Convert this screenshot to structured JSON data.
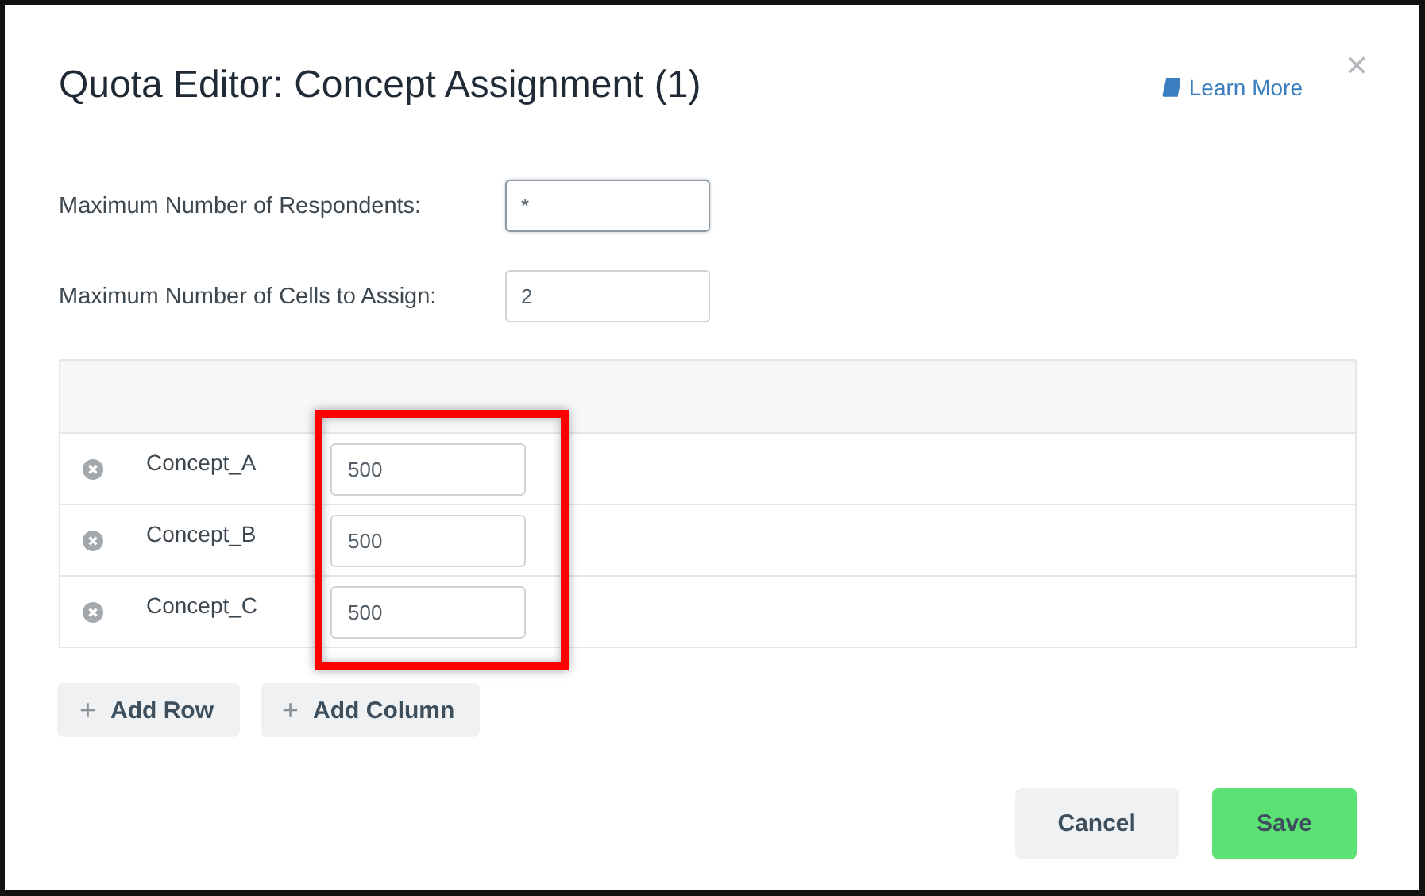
{
  "dialog": {
    "title": "Quota Editor: Concept Assignment (1)",
    "help_link": "Learn More",
    "close": "×"
  },
  "settings": [
    {
      "label": "Maximum Number of Respondents:",
      "value": "*",
      "focused": true
    },
    {
      "label": "Maximum Number of Cells to Assign:",
      "value": "2",
      "focused": false
    }
  ],
  "table": {
    "rows": [
      {
        "name": "Concept_A",
        "value": "500"
      },
      {
        "name": "Concept_B",
        "value": "500"
      },
      {
        "name": "Concept_C",
        "value": "500"
      }
    ]
  },
  "table_buttons": [
    {
      "icon": "+",
      "label": "Add Row"
    },
    {
      "icon": "+",
      "label": "Add Column"
    }
  ],
  "footer_buttons": [
    {
      "label": "Cancel",
      "kind": "secondary"
    },
    {
      "label": "Save",
      "kind": "primary"
    }
  ]
}
